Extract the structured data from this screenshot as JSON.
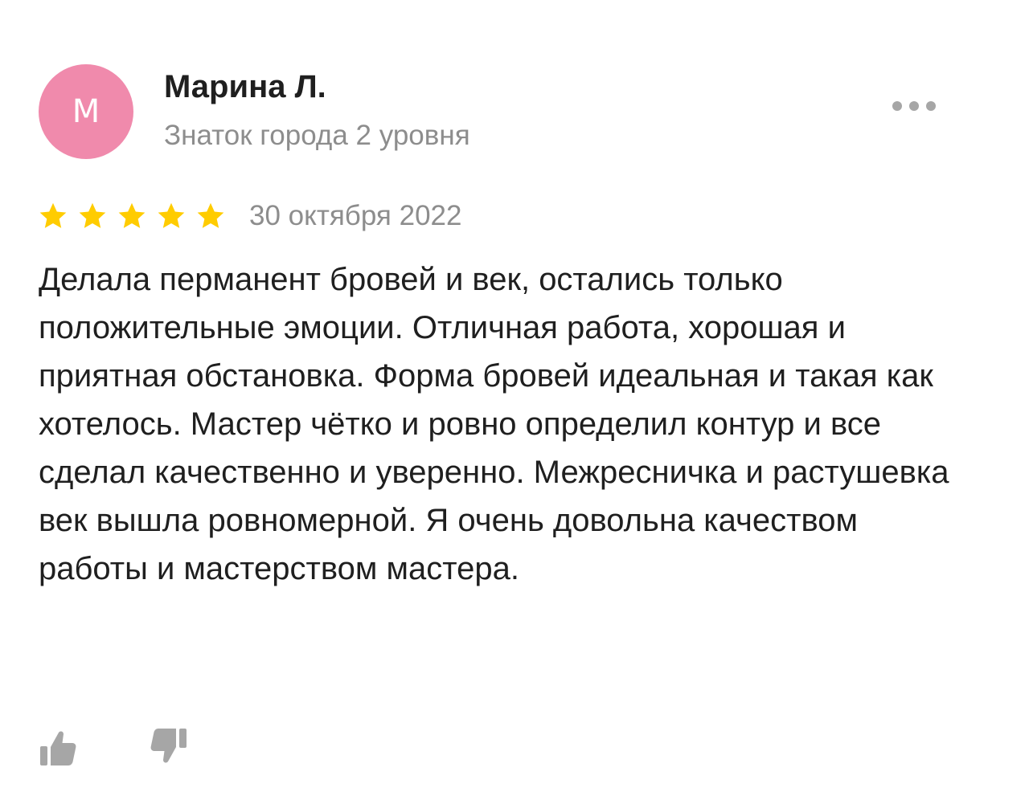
{
  "author": {
    "initial": "М",
    "name": "Марина Л.",
    "level": "Знаток города 2 уровня",
    "avatar_color": "#f08aac"
  },
  "review": {
    "rating": 5,
    "rating_max": 5,
    "date": "30 октября 2022",
    "text": "Делала перманент бровей и век, остались только положительные эмоции. Отличная работа, хорошая и приятная обстановка. Форма бровей идеальная и такая как хотелось. Мастер чётко и ровно определил контур и все сделал качественно и уверенно. Межресничка и растушевка век вышла ровномерной. Я очень довольна качеством работы и мастерством мастера."
  },
  "colors": {
    "star": "#ffcc00",
    "secondary_text": "#8d8d8d",
    "icon": "#a6a6a6"
  },
  "icons": {
    "more": "more-dots-icon",
    "like": "thumbs-up-icon",
    "dislike": "thumbs-down-icon",
    "star": "star-icon"
  }
}
